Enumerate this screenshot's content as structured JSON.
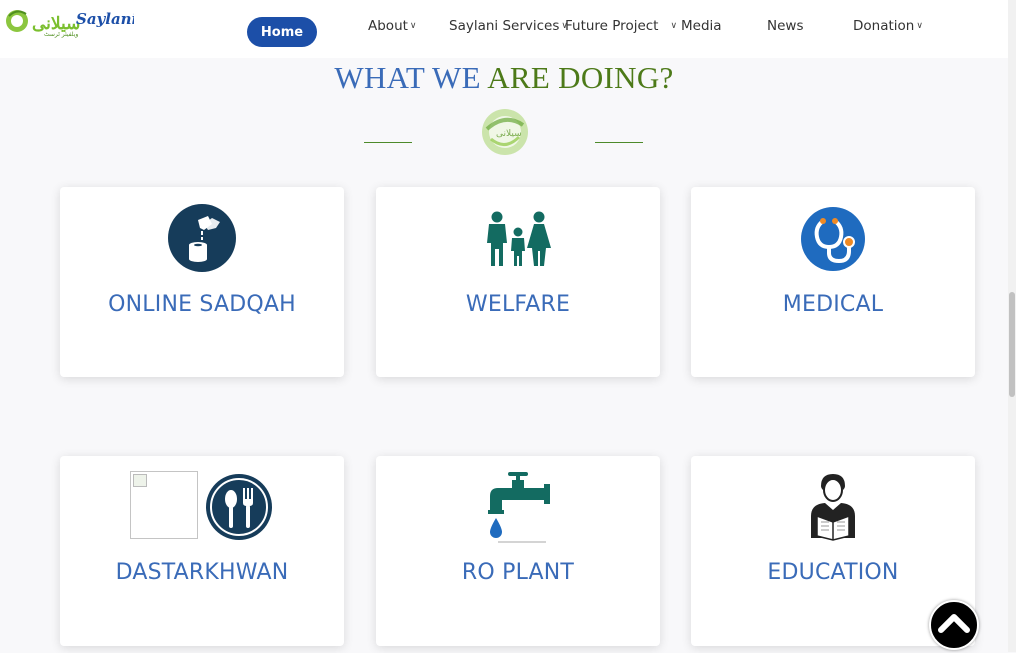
{
  "logo": {
    "text": "Saylani",
    "tagline": "ویلفیئر ٹرسٹ"
  },
  "nav": {
    "home": "Home",
    "items": [
      {
        "label": "About",
        "dropdown": true
      },
      {
        "label": "Saylani Services",
        "dropdown": true
      },
      {
        "label": "Future Project",
        "dropdown": true
      },
      {
        "label": "Media",
        "dropdown": false
      },
      {
        "label": "News",
        "dropdown": false
      },
      {
        "label": "Donation",
        "dropdown": true
      }
    ]
  },
  "section": {
    "heading_part1": "WHAT WE ",
    "heading_part2": "ARE DOING?"
  },
  "cards": [
    {
      "title": "ONLINE SADQAH",
      "icon": "donation-hand-icon"
    },
    {
      "title": "WELFARE",
      "icon": "family-icon"
    },
    {
      "title": "MEDICAL",
      "icon": "stethoscope-icon"
    },
    {
      "title": "DASTARKHWAN",
      "icon": "spoon-fork-icon"
    },
    {
      "title": "RO PLANT",
      "icon": "water-tap-icon"
    },
    {
      "title": "EDUCATION",
      "icon": "student-reading-icon"
    }
  ],
  "colors": {
    "brand_blue": "#1c4fa8",
    "title_blue": "#3a6bb8",
    "heading_green": "#4d7a19",
    "icon_navy": "#163c5a",
    "icon_teal": "#136b61"
  }
}
